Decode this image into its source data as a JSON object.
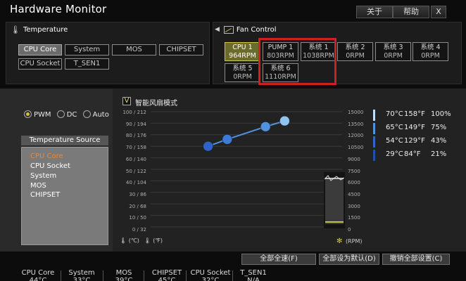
{
  "window": {
    "title": "Hardware Monitor",
    "about_label": "关于",
    "help_label": "帮助",
    "close_label": "X"
  },
  "temperature_panel": {
    "title": "Temperature",
    "sensors": [
      "CPU Core",
      "System",
      "MOS",
      "CHIPSET",
      "CPU Socket",
      "T_SEN1"
    ],
    "selected": "CPU Core"
  },
  "fan_panel": {
    "title": "Fan Control",
    "fans": [
      {
        "name": "CPU 1",
        "rpm": "964RPM"
      },
      {
        "name": "PUMP 1",
        "rpm": "803RPM"
      },
      {
        "name": "系统 1",
        "rpm": "1038RPM"
      },
      {
        "name": "系统 2",
        "rpm": "0RPM"
      },
      {
        "name": "系统 3",
        "rpm": "0RPM"
      },
      {
        "name": "系统 4",
        "rpm": "0RPM"
      },
      {
        "name": "系统 5",
        "rpm": "0RPM"
      },
      {
        "name": "系统 6",
        "rpm": "1110RPM"
      }
    ],
    "selected": "CPU 1"
  },
  "mode": {
    "options": [
      "PWM",
      "DC",
      "Auto"
    ],
    "selected": "PWM"
  },
  "temperature_source": {
    "title": "Temperature Source",
    "items": [
      "CPU Core",
      "CPU Socket",
      "System",
      "MOS",
      "CHIPSET"
    ],
    "selected": "CPU Core"
  },
  "smart_fan": {
    "label": "智能风扇模式",
    "checked": true,
    "check_glyph": "V"
  },
  "axes": {
    "left_ticks": [
      "100 / 212",
      "90 / 194",
      "80 / 176",
      "70 / 158",
      "60 / 140",
      "50 / 122",
      "40 / 104",
      "30 /  86",
      "20 /  68",
      "10 /  50",
      "0 /  32"
    ],
    "right_ticks": [
      "15000",
      "13500",
      "12000",
      "10500",
      "9000",
      "7500",
      "6000",
      "4500",
      "3000",
      "1500",
      "0"
    ],
    "celsius_unit": "(℃)",
    "fahrenheit_unit": "(℉)",
    "rpm_unit": "(RPM)"
  },
  "chart_data": {
    "type": "line",
    "x": [
      30,
      40,
      60,
      70
    ],
    "y": [
      70,
      76,
      87,
      92
    ],
    "ylim": [
      0,
      100
    ],
    "xlim": [
      0,
      100
    ],
    "colors": [
      "#2f63c8",
      "#3c7bd6",
      "#4f93e0",
      "#8fc4f0"
    ]
  },
  "legend": [
    {
      "celsius": "70°C",
      "fahrenheit": "158°F",
      "percent": "100%",
      "color": "#bde0fb"
    },
    {
      "celsius": "65°C",
      "fahrenheit": "149°F",
      "percent": "75%",
      "color": "#4f93e0"
    },
    {
      "celsius": "54°C",
      "fahrenheit": "129°F",
      "percent": "43%",
      "color": "#3267c9"
    },
    {
      "celsius": "29°C",
      "fahrenheit": "84°F",
      "percent": "21%",
      "color": "#234fa8"
    }
  ],
  "bottom_buttons": {
    "full_speed": "全部全速(F)",
    "set_default": "全部设为默认(D)",
    "undo_all": "撤销全部设置(C)"
  },
  "status_bar": [
    {
      "name": "CPU Core",
      "value": "44°C"
    },
    {
      "name": "System",
      "value": "33°C"
    },
    {
      "name": "MOS",
      "value": "39°C"
    },
    {
      "name": "CHIPSET",
      "value": "45°C"
    },
    {
      "name": "CPU Socket",
      "value": "32°C"
    },
    {
      "name": "T_SEN1",
      "value": "N/A"
    }
  ]
}
